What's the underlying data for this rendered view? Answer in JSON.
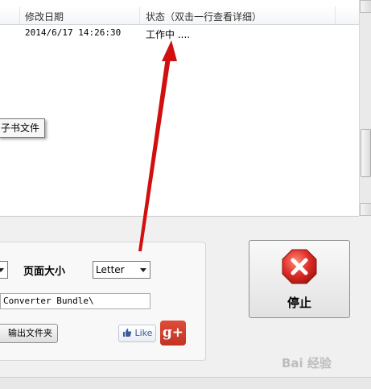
{
  "file_list": {
    "headers": {
      "modified": "修改日期",
      "status": "状态（双击一行查看详细）"
    },
    "rows": [
      {
        "modified": "2014/6/17 14:26:30",
        "status": "工作中 ...."
      }
    ]
  },
  "tooltip": {
    "text": "子书文件"
  },
  "settings": {
    "page_size_label": "页面大小",
    "page_size_value": "Letter",
    "output_path": "Converter Bundle\\",
    "output_folder_button": "输出文件夹",
    "like_label": "Like",
    "gplus_label": "g+"
  },
  "stop_button": {
    "label": "停止"
  },
  "watermark": {
    "text": "Bai 经验"
  },
  "colors": {
    "arrow": "#d10f0f",
    "stop_icon": "#d82a2a",
    "gplus": "#d14836"
  },
  "icons": [
    "stop-icon",
    "thumbs-up-icon",
    "google-plus-icon",
    "dropdown-arrow-icon"
  ]
}
